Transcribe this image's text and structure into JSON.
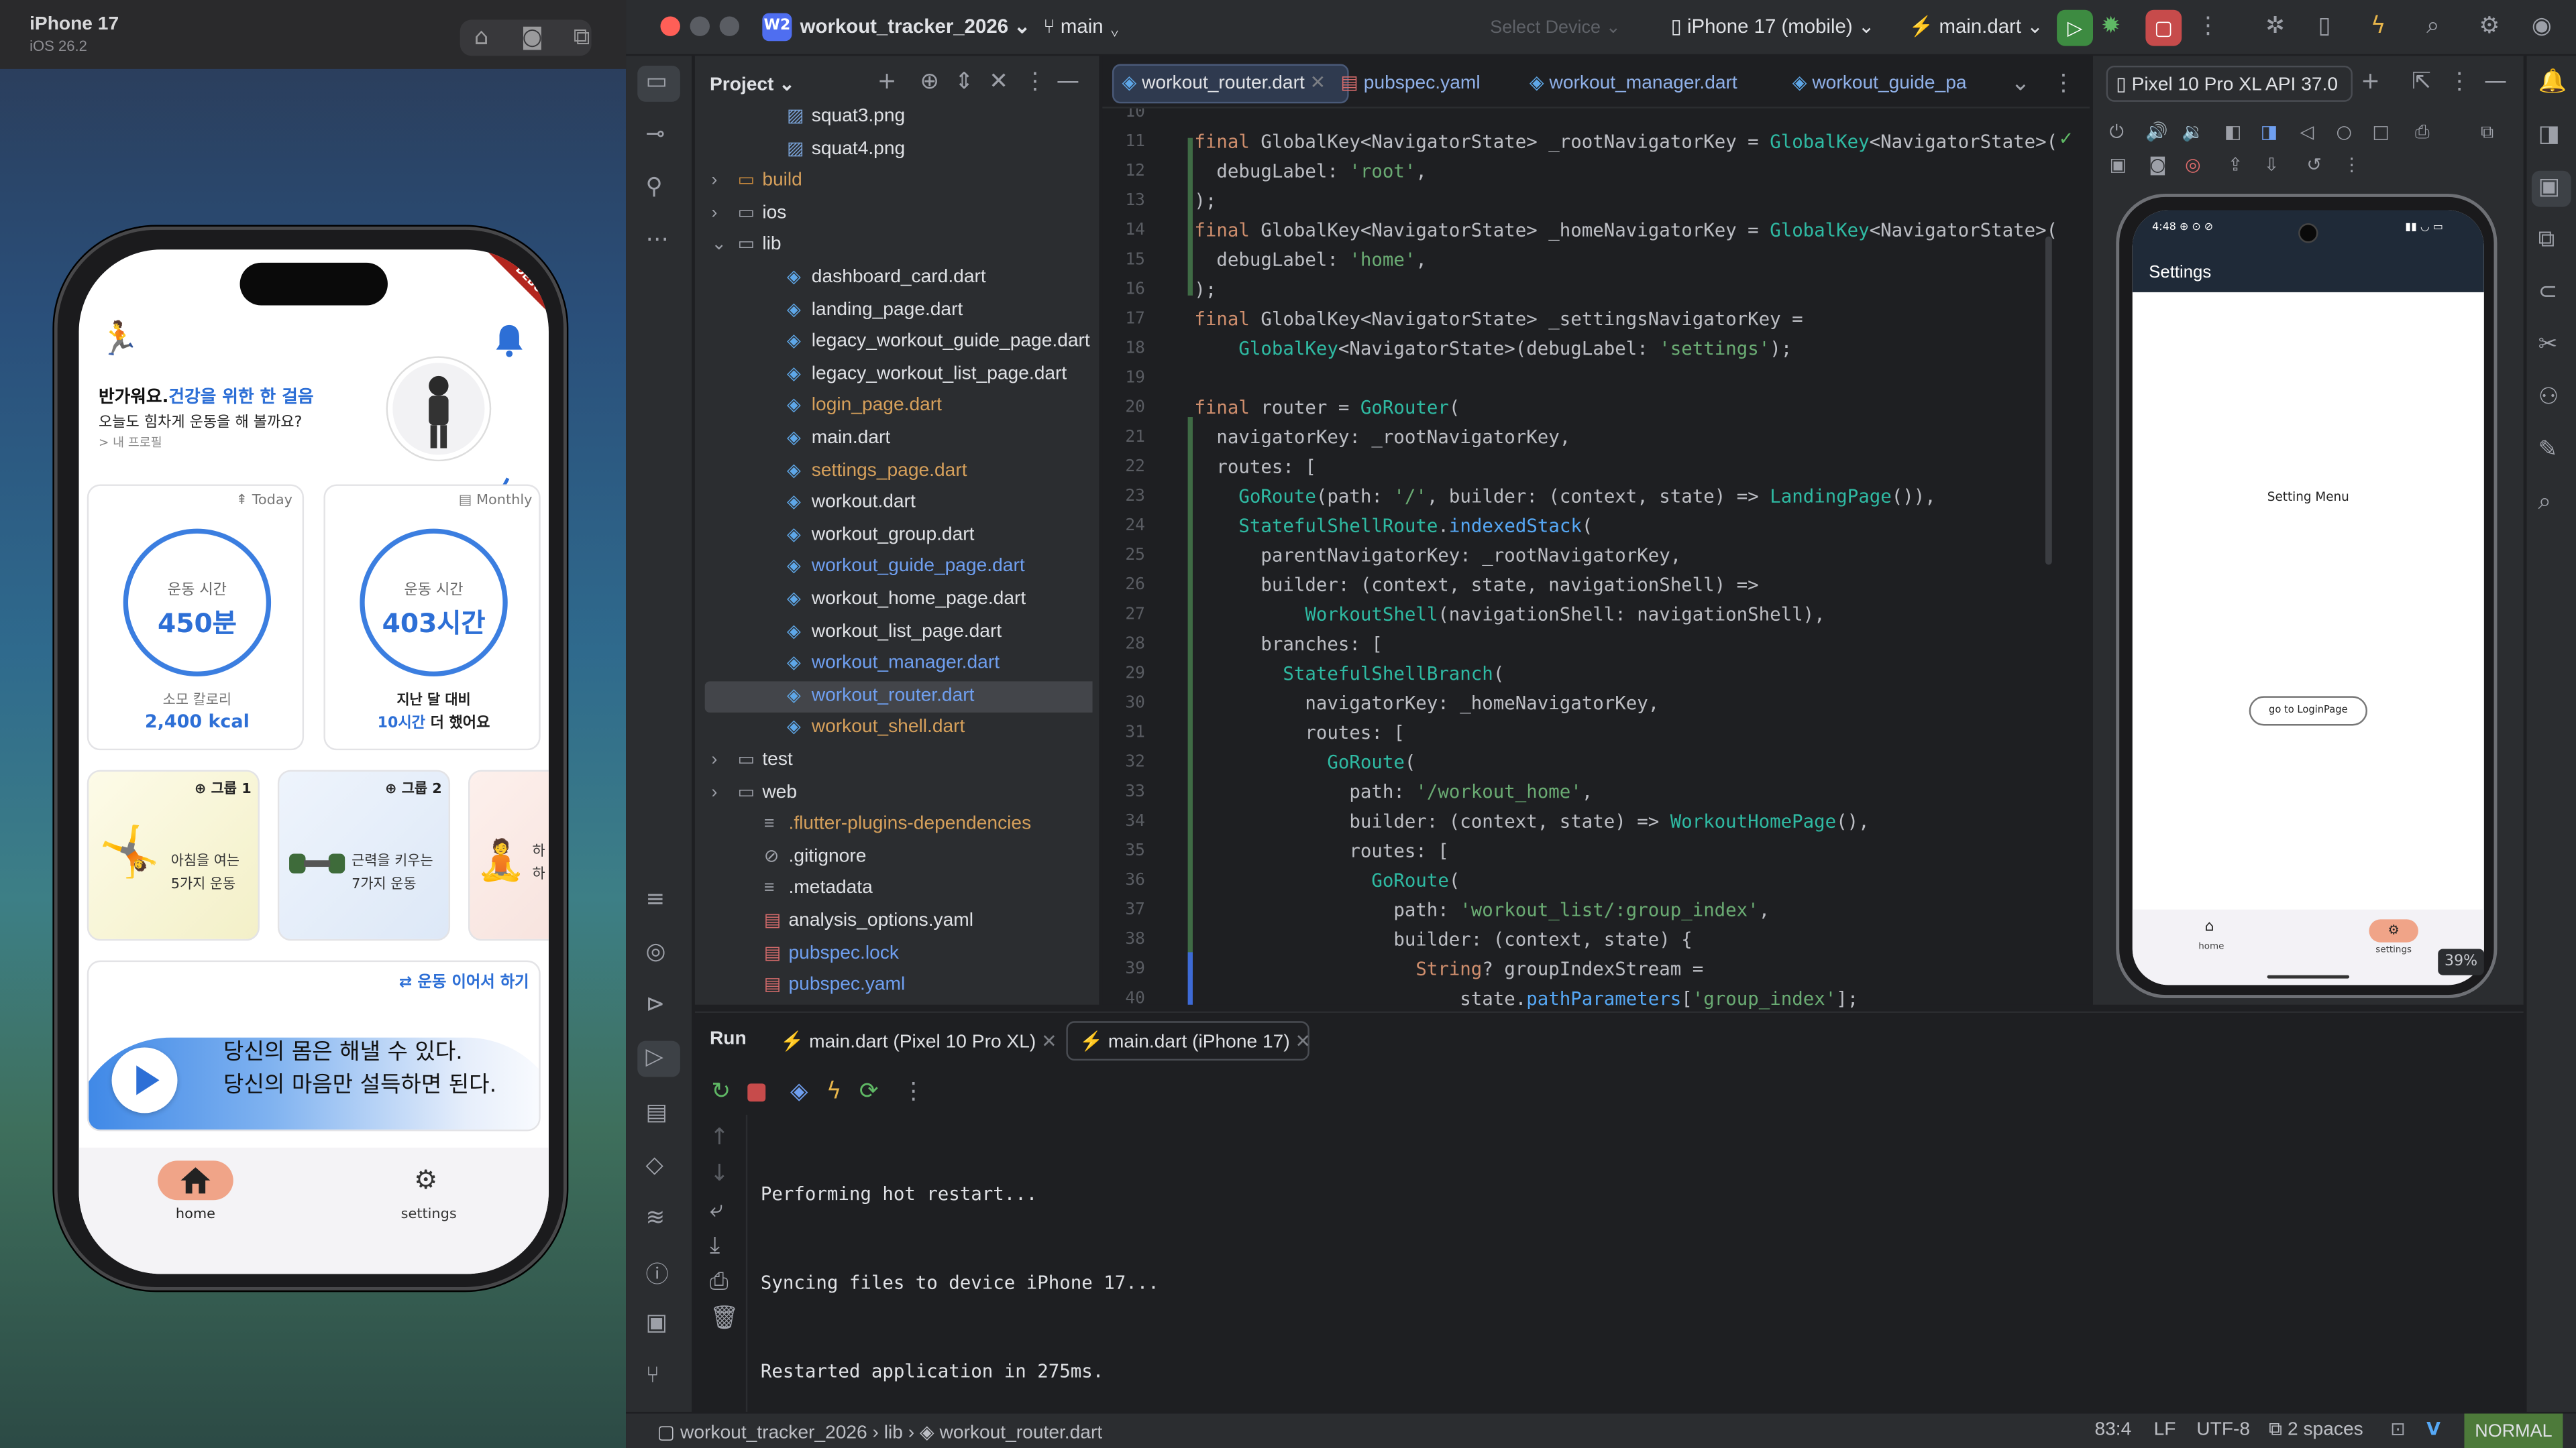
{
  "simulator": {
    "device": "iPhone 17",
    "os": "iOS 26.2",
    "app": {
      "greeting_prefix": "반가워요.",
      "greeting_highlight": "건강을 위한 한 걸음",
      "greeting_sub": "오늘도 힘차게 운동을 해 볼까요?",
      "profile_link": "> 내 프로필",
      "today_card": {
        "tag": "Today",
        "label": "운동 시간",
        "value": "450분",
        "cal_label": "소모 칼로리",
        "cal_value": "2,400 kcal"
      },
      "monthly_card": {
        "tag": "Monthly",
        "label": "운동 시간",
        "value": "403시간",
        "compare_label": "지난 달 대비",
        "compare_value": "10시간",
        "compare_suffix": " 더 했어요"
      },
      "groups": [
        {
          "tag": "그룹 1",
          "text1": "아침을 여는",
          "text2": "5가지 운동"
        },
        {
          "tag": "그룹 2",
          "text1": "근력을 키우는",
          "text2": "7가지 운동"
        },
        {
          "tag": "",
          "text1": "하",
          "text2": "하"
        }
      ],
      "continue_label": "운동 이어서 하기",
      "quote_line1": "당신의 몸은 해낼 수 있다.",
      "quote_line2": "당신의 마음만 설득하면 된다.",
      "nav_home": "home",
      "nav_settings": "settings",
      "debug_banner": "DEBUG"
    }
  },
  "ide": {
    "project_name": "workout_tracker_2026",
    "branch": "main",
    "select_device": "Select Device",
    "device": "iPhone 17 (mobile)",
    "run_config": "main.dart",
    "project_label": "Project",
    "tree": [
      {
        "name": "squat3.png",
        "indent": 3,
        "kind": "img",
        "color": "#dfe1e5",
        "arrow": ""
      },
      {
        "name": "squat4.png",
        "indent": 3,
        "kind": "img",
        "color": "#dfe1e5",
        "arrow": ""
      },
      {
        "name": "build",
        "indent": 1,
        "kind": "folder-orange",
        "color": "#d6a05b",
        "arrow": "›"
      },
      {
        "name": "ios",
        "indent": 1,
        "kind": "folder",
        "color": "#dfe1e5",
        "arrow": "›"
      },
      {
        "name": "lib",
        "indent": 1,
        "kind": "folder",
        "color": "#dfe1e5",
        "arrow": "⌄"
      },
      {
        "name": "dashboard_card.dart",
        "indent": 3,
        "kind": "dart",
        "color": "#dfe1e5",
        "arrow": ""
      },
      {
        "name": "landing_page.dart",
        "indent": 3,
        "kind": "dart",
        "color": "#dfe1e5",
        "arrow": ""
      },
      {
        "name": "legacy_workout_guide_page.dart",
        "indent": 3,
        "kind": "dart",
        "color": "#dfe1e5",
        "arrow": ""
      },
      {
        "name": "legacy_workout_list_page.dart",
        "indent": 3,
        "kind": "dart",
        "color": "#dfe1e5",
        "arrow": ""
      },
      {
        "name": "login_page.dart",
        "indent": 3,
        "kind": "dart",
        "color": "#d6a05b",
        "arrow": ""
      },
      {
        "name": "main.dart",
        "indent": 3,
        "kind": "dart",
        "color": "#dfe1e5",
        "arrow": ""
      },
      {
        "name": "settings_page.dart",
        "indent": 3,
        "kind": "dart",
        "color": "#d6a05b",
        "arrow": ""
      },
      {
        "name": "workout.dart",
        "indent": 3,
        "kind": "dart",
        "color": "#dfe1e5",
        "arrow": ""
      },
      {
        "name": "workout_group.dart",
        "indent": 3,
        "kind": "dart",
        "color": "#dfe1e5",
        "arrow": ""
      },
      {
        "name": "workout_guide_page.dart",
        "indent": 3,
        "kind": "dart",
        "color": "#6f9ff0",
        "arrow": ""
      },
      {
        "name": "workout_home_page.dart",
        "indent": 3,
        "kind": "dart",
        "color": "#dfe1e5",
        "arrow": ""
      },
      {
        "name": "workout_list_page.dart",
        "indent": 3,
        "kind": "dart",
        "color": "#dfe1e5",
        "arrow": ""
      },
      {
        "name": "workout_manager.dart",
        "indent": 3,
        "kind": "dart",
        "color": "#6f9ff0",
        "arrow": ""
      },
      {
        "name": "workout_router.dart",
        "indent": 3,
        "kind": "dart",
        "color": "#6f9ff0",
        "arrow": "",
        "selected": true
      },
      {
        "name": "workout_shell.dart",
        "indent": 3,
        "kind": "dart",
        "color": "#d6a05b",
        "arrow": ""
      },
      {
        "name": "test",
        "indent": 1,
        "kind": "folder",
        "color": "#dfe1e5",
        "arrow": "›"
      },
      {
        "name": "web",
        "indent": 1,
        "kind": "folder",
        "color": "#dfe1e5",
        "arrow": "›"
      },
      {
        "name": ".flutter-plugins-dependencies",
        "indent": 2,
        "kind": "text",
        "color": "#d6a05b",
        "arrow": ""
      },
      {
        "name": ".gitignore",
        "indent": 2,
        "kind": "ignore",
        "color": "#dfe1e5",
        "arrow": ""
      },
      {
        "name": ".metadata",
        "indent": 2,
        "kind": "text",
        "color": "#dfe1e5",
        "arrow": ""
      },
      {
        "name": "analysis_options.yaml",
        "indent": 2,
        "kind": "yaml",
        "color": "#dfe1e5",
        "arrow": ""
      },
      {
        "name": "pubspec.lock",
        "indent": 2,
        "kind": "yaml",
        "color": "#6f9ff0",
        "arrow": ""
      },
      {
        "name": "pubspec.yaml",
        "indent": 2,
        "kind": "yaml",
        "color": "#6f9ff0",
        "arrow": ""
      }
    ],
    "tabs": [
      "workout_router.dart",
      "pubspec.yaml",
      "workout_manager.dart",
      "workout_guide_pa"
    ],
    "line_numbers": [
      "10",
      "11",
      "12",
      "13",
      "14",
      "15",
      "16",
      "17",
      "18",
      "19",
      "20",
      "21",
      "22",
      "23",
      "24",
      "25",
      "26",
      "27",
      "28",
      "29",
      "30",
      "31",
      "32",
      "33",
      "34",
      "35",
      "36",
      "37",
      "38",
      "39",
      "40"
    ],
    "emulator": {
      "title": "Pixel 10 Pro XL API 37.0",
      "time": "4:48",
      "appbar": "Settings",
      "content": "Setting Menu",
      "button": "go to LoginPage",
      "nav_home": "home",
      "nav_settings": "settings",
      "zoom": "39%"
    },
    "run": {
      "label": "Run",
      "tabs": [
        "main.dart (Pixel 10 Pro XL)",
        "main.dart (iPhone 17)"
      ],
      "output": [
        "Performing hot restart...",
        "Syncing files to device iPhone 17...",
        "Restarted application in 275ms."
      ]
    },
    "status": {
      "crumbs": [
        "workout_tracker_2026",
        "lib",
        "workout_router.dart"
      ],
      "position": "83:4",
      "line_sep": "LF",
      "encoding": "UTF-8",
      "indent": "2 spaces",
      "mode": "NORMAL"
    }
  }
}
